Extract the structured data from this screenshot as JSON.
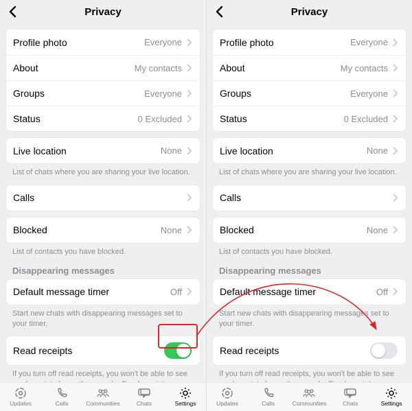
{
  "header": {
    "title": "Privacy"
  },
  "rows": {
    "profile_photo": {
      "label": "Profile photo",
      "value": "Everyone"
    },
    "about": {
      "label": "About",
      "value": "My contacts"
    },
    "groups": {
      "label": "Groups",
      "value": "Everyone"
    },
    "status": {
      "label": "Status",
      "value": "0 Excluded"
    },
    "live_location": {
      "label": "Live location",
      "value": "None"
    },
    "calls": {
      "label": "Calls",
      "value": ""
    },
    "blocked": {
      "label": "Blocked",
      "value": "None"
    },
    "default_timer": {
      "label": "Default message timer",
      "value": "Off"
    },
    "read_receipts": {
      "label": "Read receipts"
    }
  },
  "hints": {
    "live_location": "List of chats where you are sharing your live location.",
    "blocked": "List of contacts you have blocked.",
    "timer": "Start new chats with disappearing messages set to your timer.",
    "read_receipts": "If you turn off read receipts, you won't be able to see read receipts from other people. Read receipts are always sent for group chats."
  },
  "sections": {
    "disappearing": "Disappearing messages"
  },
  "toggle": {
    "left_on": true,
    "right_on": false
  },
  "tabs": {
    "updates": "Updates",
    "calls": "Calls",
    "communities": "Communities",
    "chats": "Chats",
    "settings": "Settings"
  },
  "colors": {
    "accent_green": "#34c759",
    "highlight_red": "#d9262a"
  }
}
